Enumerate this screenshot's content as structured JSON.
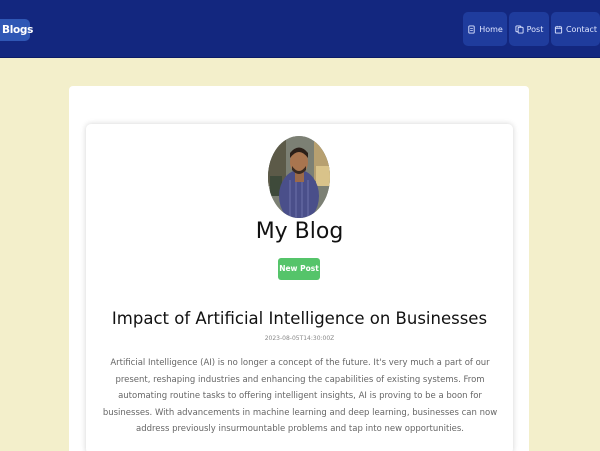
{
  "navbar": {
    "brand": "Blogs",
    "items": [
      {
        "label": "Home",
        "icon": "document-icon"
      },
      {
        "label": "Post",
        "icon": "copy-icon"
      },
      {
        "label": "Contact",
        "icon": "calendar-icon"
      }
    ]
  },
  "colors": {
    "navbar_bg": "#13277f",
    "page_bg": "#f3efcb",
    "accent_button": "#55c46a"
  },
  "profile": {
    "title": "My Blog",
    "new_post_label": "New Post"
  },
  "post": {
    "title": "Impact of Artificial Intelligence on Businesses",
    "date": "2023-08-05T14:30:00Z",
    "body": "Artificial Intelligence (AI) is no longer a concept of the future. It's very much a part of our present, reshaping industries and enhancing the capabilities of existing systems. From automating routine tasks to offering intelligent insights, AI is proving to be a boon for businesses. With advancements in machine learning and deep learning, businesses can now address previously insurmountable problems and tap into new opportunities."
  }
}
